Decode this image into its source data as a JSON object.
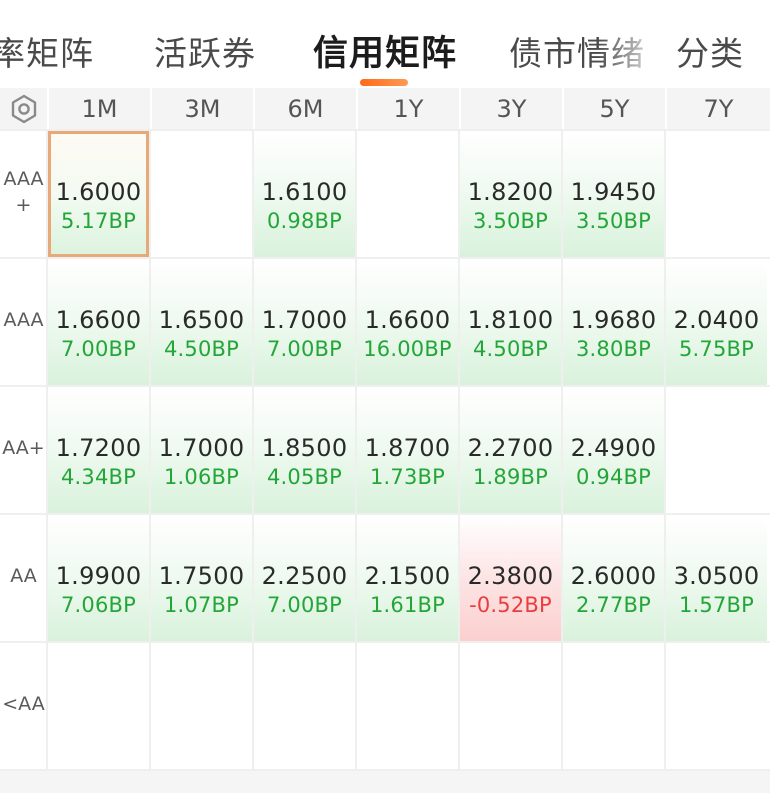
{
  "tabs": [
    {
      "label": "率矩阵",
      "active": false
    },
    {
      "label": "活跃券",
      "active": false
    },
    {
      "label": "信用矩阵",
      "active": true
    },
    {
      "label": "债市情绪",
      "active": false
    },
    {
      "label": "分类",
      "active": false
    }
  ],
  "matrix": {
    "settings_icon": "hexagon-gear-icon",
    "columns": [
      "1M",
      "3M",
      "6M",
      "1Y",
      "3Y",
      "5Y",
      "7Y"
    ],
    "rows": [
      {
        "label": "AAA\n+",
        "cells": [
          {
            "yield": "1.6000",
            "change": "5.17BP",
            "dir": "pos",
            "selected": true
          },
          null,
          {
            "yield": "1.6100",
            "change": "0.98BP",
            "dir": "pos"
          },
          null,
          {
            "yield": "1.8200",
            "change": "3.50BP",
            "dir": "pos"
          },
          {
            "yield": "1.9450",
            "change": "3.50BP",
            "dir": "pos"
          },
          null
        ]
      },
      {
        "label": "AAA",
        "cells": [
          {
            "yield": "1.6600",
            "change": "7.00BP",
            "dir": "pos"
          },
          {
            "yield": "1.6500",
            "change": "4.50BP",
            "dir": "pos"
          },
          {
            "yield": "1.7000",
            "change": "7.00BP",
            "dir": "pos"
          },
          {
            "yield": "1.6600",
            "change": "16.00BP",
            "dir": "pos"
          },
          {
            "yield": "1.8100",
            "change": "4.50BP",
            "dir": "pos"
          },
          {
            "yield": "1.9680",
            "change": "3.80BP",
            "dir": "pos"
          },
          {
            "yield": "2.0400",
            "change": "5.75BP",
            "dir": "pos"
          }
        ]
      },
      {
        "label": "AA+",
        "cells": [
          {
            "yield": "1.7200",
            "change": "4.34BP",
            "dir": "pos"
          },
          {
            "yield": "1.7000",
            "change": "1.06BP",
            "dir": "pos"
          },
          {
            "yield": "1.8500",
            "change": "4.05BP",
            "dir": "pos"
          },
          {
            "yield": "1.8700",
            "change": "1.73BP",
            "dir": "pos"
          },
          {
            "yield": "2.2700",
            "change": "1.89BP",
            "dir": "pos"
          },
          {
            "yield": "2.4900",
            "change": "0.94BP",
            "dir": "pos"
          },
          null
        ]
      },
      {
        "label": "AA",
        "cells": [
          {
            "yield": "1.9900",
            "change": "7.06BP",
            "dir": "pos"
          },
          {
            "yield": "1.7500",
            "change": "1.07BP",
            "dir": "pos"
          },
          {
            "yield": "2.2500",
            "change": "7.00BP",
            "dir": "pos"
          },
          {
            "yield": "2.1500",
            "change": "1.61BP",
            "dir": "pos"
          },
          {
            "yield": "2.3800",
            "change": "-0.52BP",
            "dir": "neg"
          },
          {
            "yield": "2.6000",
            "change": "2.77BP",
            "dir": "pos"
          },
          {
            "yield": "3.0500",
            "change": "1.57BP",
            "dir": "pos"
          }
        ]
      },
      {
        "label": "<AA",
        "cells": [
          null,
          null,
          null,
          null,
          null,
          null,
          null
        ]
      }
    ]
  },
  "colors": {
    "accent": "#ff6a1a",
    "positive": "#23a638",
    "negative": "#ea3d3d",
    "selected_border": "#e7a978"
  }
}
